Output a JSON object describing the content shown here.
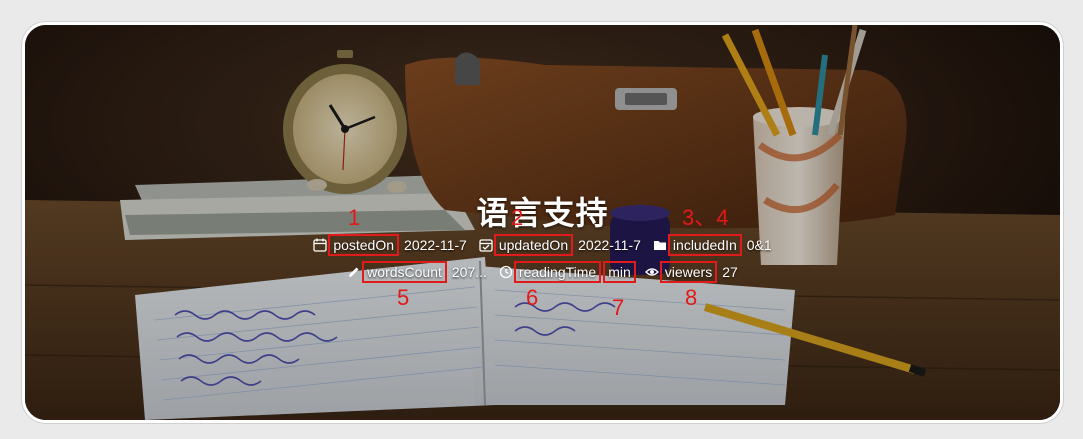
{
  "title": "语言支持",
  "meta": {
    "posted_label": "postedOn",
    "posted_value": "2022-11-7",
    "updated_label": "updatedOn",
    "updated_value": "2022-11-7",
    "included_label": "includedIn",
    "included_value": "0&1",
    "words_label": "wordsCount",
    "words_value": "207",
    "words_ellipsis": "...",
    "reading_label": "readingTime",
    "reading_unit": "min",
    "viewers_label": "viewers",
    "viewers_value": "27"
  },
  "annotations": [
    "1",
    "2",
    "3、4",
    "5",
    "6",
    "7",
    "8"
  ],
  "colors": {
    "annotation": "#e31919",
    "text": "#ffffff",
    "frame": "#ffffff"
  },
  "icons": {
    "posted": "calendar-icon",
    "updated": "calendar-check-icon",
    "included": "folder-icon",
    "words": "pencil-icon",
    "reading": "clock-icon",
    "viewers": "eye-icon"
  }
}
